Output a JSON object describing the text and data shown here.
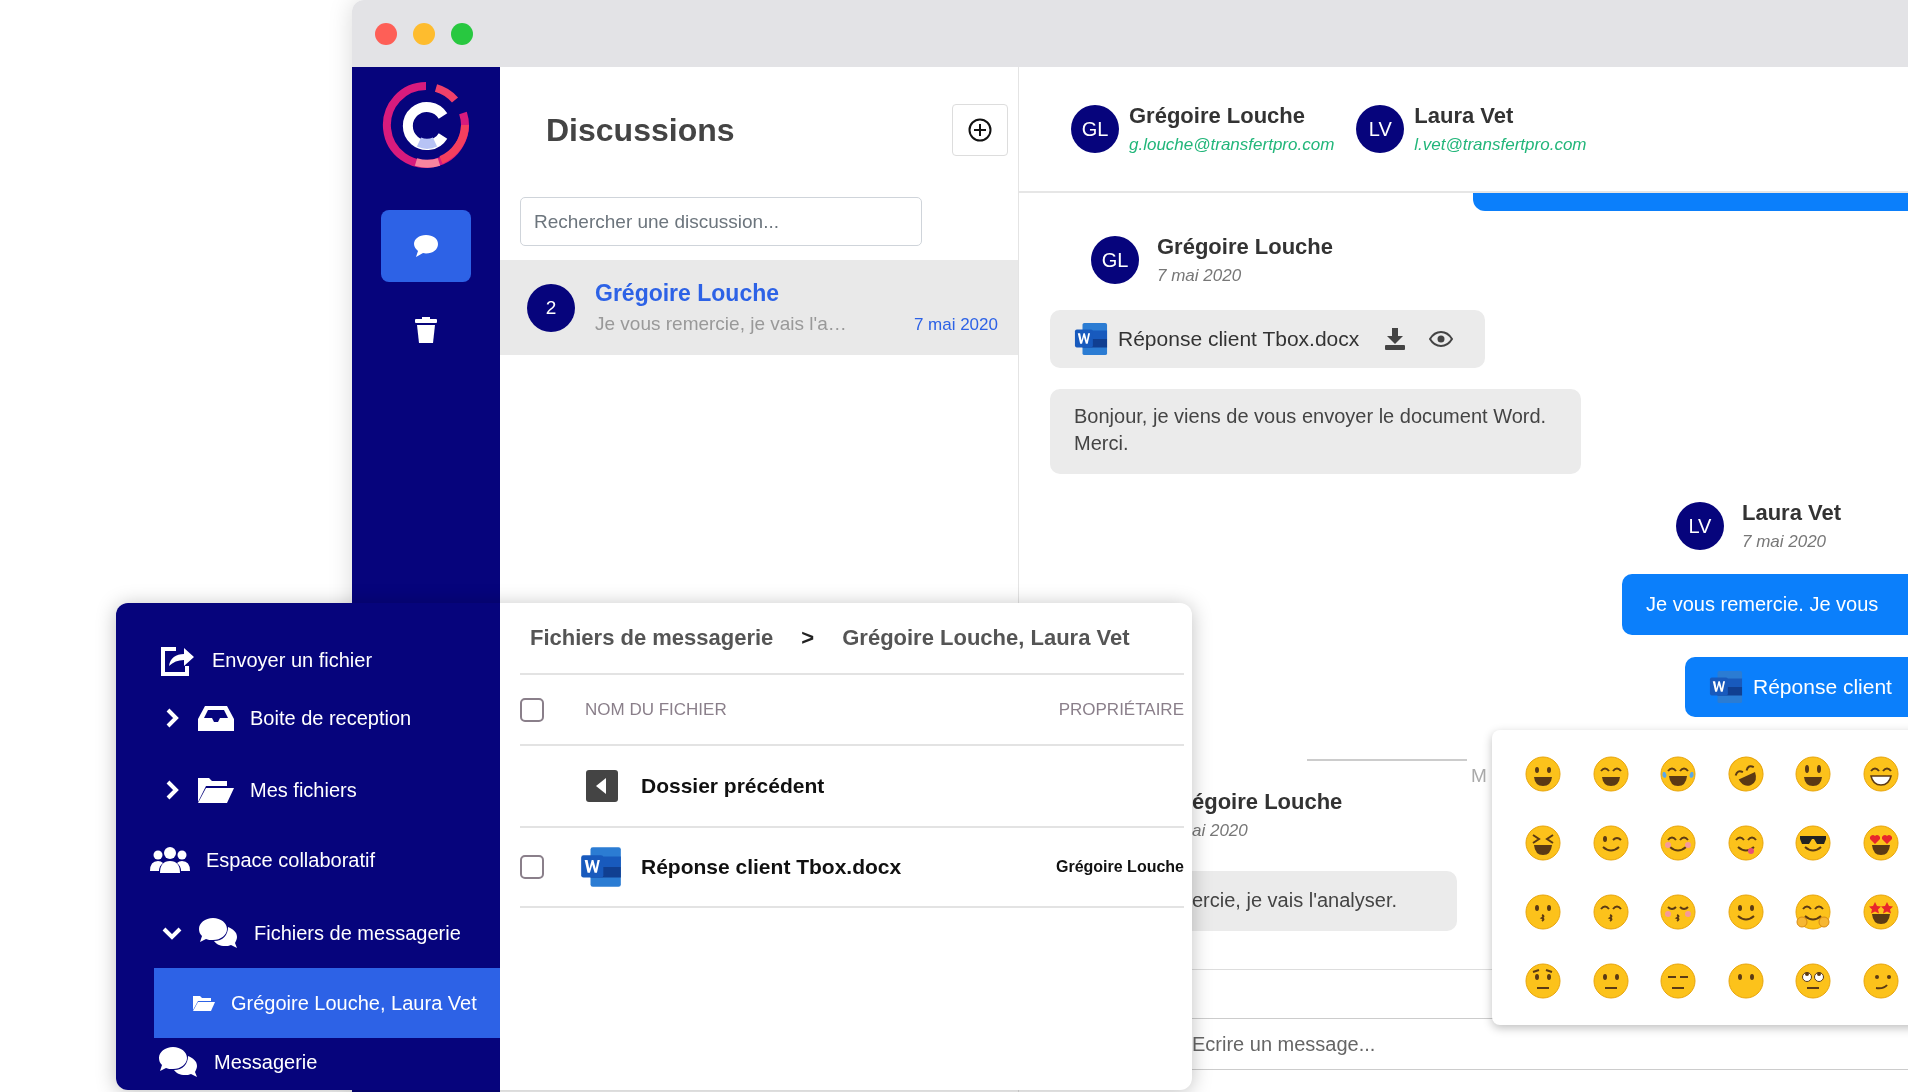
{
  "app_sidebar": {
    "items": [
      {
        "kind": "chat",
        "selected": true
      },
      {
        "kind": "trash",
        "selected": false
      }
    ]
  },
  "discussions": {
    "title": "Discussions",
    "search": {
      "placeholder": "Rechercher une discussion..."
    },
    "items": [
      {
        "badge": "2",
        "name": "Grégoire Louche",
        "preview": "Je vous remercie, je vais l'a…",
        "date": "7 mai 2020",
        "selected": true
      }
    ]
  },
  "chat": {
    "participants": [
      {
        "initials": "GL",
        "name": "Grégoire Louche",
        "email": "g.louche@transfertpro.com"
      },
      {
        "initials": "LV",
        "name": "Laura Vet",
        "email": "l.vet@transfertpro.com"
      }
    ],
    "messages": [
      {
        "kind": "cut-bubble"
      },
      {
        "kind": "author",
        "outgoing": false,
        "initials": "GL",
        "name": "Grégoire Louche",
        "date": "7 mai 2020"
      },
      {
        "kind": "file",
        "outgoing": false,
        "filename": "Réponse client Tbox.docx"
      },
      {
        "kind": "text",
        "outgoing": false,
        "lines": [
          "Bonjour, je viens de vous envoyer le document Word.",
          "Merci."
        ]
      },
      {
        "kind": "author",
        "outgoing": true,
        "initials": "LV",
        "name": "Laura Vet",
        "date": "7 mai 2020"
      },
      {
        "kind": "text",
        "outgoing": true,
        "lines": [
          "Je vous remercie. Je vous"
        ]
      },
      {
        "kind": "file",
        "outgoing": true,
        "filename": "Réponse client"
      },
      {
        "kind": "divider",
        "label": "M"
      },
      {
        "kind": "cut-author",
        "name": "égoire Louche",
        "date": "ai 2020"
      },
      {
        "kind": "cut-text",
        "lines": [
          "ercie, je vais l'analyser."
        ]
      }
    ],
    "composer": {
      "placeholder": "Ecrire un message..."
    },
    "emoji_picker": {
      "emojis": [
        {
          "kind": "grinning"
        },
        {
          "kind": "beaming"
        },
        {
          "kind": "joy"
        },
        {
          "kind": "rofl"
        },
        {
          "kind": "smiley"
        },
        {
          "kind": "grin"
        },
        {
          "kind": "laughing"
        },
        {
          "kind": "wink"
        },
        {
          "kind": "blush"
        },
        {
          "kind": "yum"
        },
        {
          "kind": "sunglasses"
        },
        {
          "kind": "heart-eyes"
        },
        {
          "kind": "kissing"
        },
        {
          "kind": "kissing-smiling"
        },
        {
          "kind": "kissing-closed"
        },
        {
          "kind": "slight-smile"
        },
        {
          "kind": "hugging"
        },
        {
          "kind": "star-struck"
        },
        {
          "kind": "raised-eyebrow"
        },
        {
          "kind": "neutral"
        },
        {
          "kind": "expressionless"
        },
        {
          "kind": "no-mouth"
        },
        {
          "kind": "eye-roll"
        },
        {
          "kind": "smirk"
        }
      ]
    }
  },
  "files_window": {
    "nav": [
      {
        "kind": "send",
        "label": "Envoyer un fichier"
      },
      {
        "kind": "inbox",
        "label": "Boite de reception",
        "expanded": false
      },
      {
        "kind": "folder",
        "label": "Mes fichiers",
        "expanded": false
      },
      {
        "kind": "users",
        "label": "Espace collaboratif"
      },
      {
        "kind": "chat",
        "label": "Fichiers de messagerie",
        "expanded": true,
        "children": [
          {
            "kind": "folder",
            "label": "Grégoire Louche, Laura Vet",
            "selected": true
          }
        ]
      },
      {
        "kind": "chat",
        "label": "Messagerie"
      }
    ],
    "breadcrumb": {
      "items": [
        "Fichiers de messagerie",
        "Grégoire Louche, Laura Vet"
      ],
      "separator": ">"
    },
    "table": {
      "select_all": {
        "checked": false
      },
      "columns": [
        "NOM DU FICHIER",
        "PROPRIÉTAIRE"
      ],
      "rows": [
        {
          "kind": "back",
          "name": "Dossier précédent"
        },
        {
          "kind": "file",
          "name": "Réponse client Tbox.docx",
          "owner": "Grégoire Louche",
          "checked": false
        }
      ]
    }
  }
}
